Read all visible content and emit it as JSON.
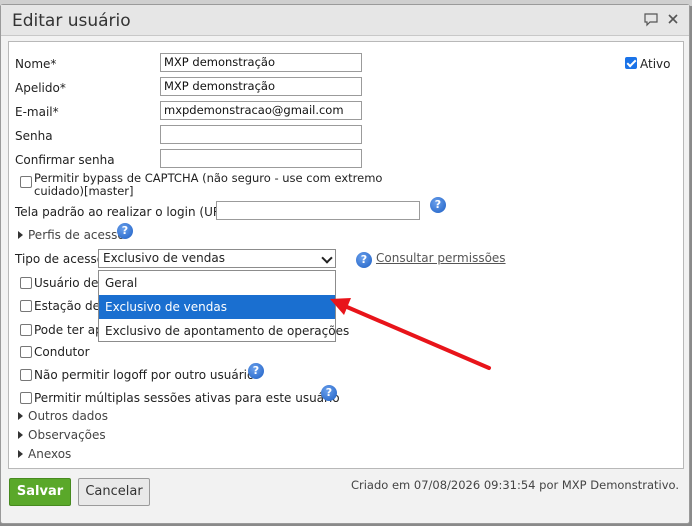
{
  "dialog": {
    "title": "Editar usuário"
  },
  "form": {
    "nome_label": "Nome*",
    "nome_value": "MXP demonstração",
    "apelido_label": "Apelido*",
    "apelido_value": "MXP demonstração",
    "email_label": "E-mail*",
    "email_value": "mxpdemonstracao@gmail.com",
    "senha_label": "Senha",
    "senha_value": "",
    "confirmar_label": "Confirmar senha",
    "confirmar_value": "",
    "captcha_label_line1": "Permitir bypass de CAPTCHA (não seguro - use com extremo",
    "captcha_label_line2": "cuidado)[master]",
    "captcha_checked": false,
    "tela_label": "Tela padrão ao realizar o login (URL)",
    "tela_value": "",
    "perfis_label": "Perfis de acesso",
    "tipo_label": "Tipo de acesso",
    "tipo_selected": "Exclusivo de vendas",
    "tipo_options": [
      "Geral",
      "Exclusivo de vendas",
      "Exclusivo de apontamento de operações"
    ],
    "consultar_link": "Consultar permissões",
    "usuario_label": "Usuário de e",
    "estacao_label": "Estação de t",
    "pode_label": "Pode ter apo",
    "condutor_label": "Condutor",
    "logoff_label": "Não permitir logoff por outro usuário",
    "sessoes_label": "Permitir múltiplas sessões ativas para este usuário",
    "outros_label": "Outros dados",
    "observacoes_label": "Observações",
    "anexos_label": "Anexos",
    "ativo_label": "Ativo",
    "ativo_checked": true
  },
  "footer": {
    "save_label": "Salvar",
    "cancel_label": "Cancelar",
    "created_text": "Criado em 07/08/2026 09:31:54 por MXP Demonstrativo."
  },
  "colors": {
    "save_button": "#5aa82a",
    "selected_option": "#1a6fd0",
    "arrow": "#e8141a",
    "help_icon": "#1d5fc4"
  },
  "icons": {
    "chat": "chat-bubble-icon",
    "close": "close-icon",
    "help": "help-icon"
  }
}
